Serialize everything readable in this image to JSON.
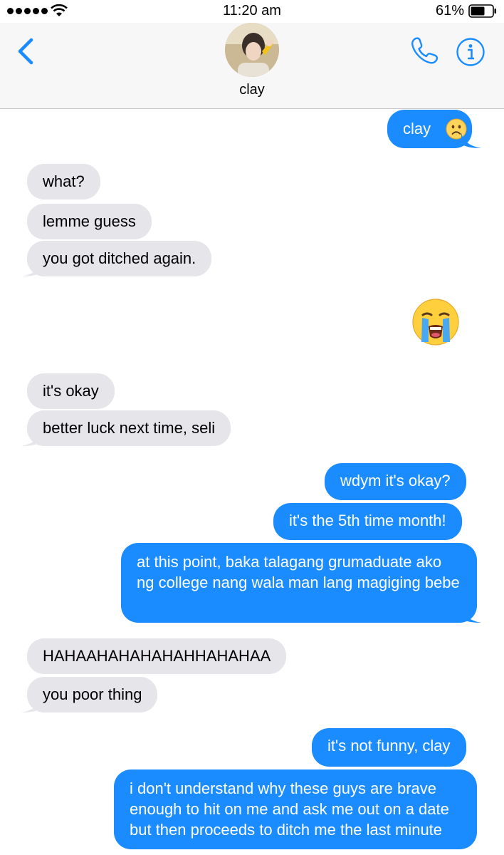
{
  "status_bar": {
    "time": "11:20 am",
    "battery": "61%"
  },
  "header": {
    "contact_name": "clay"
  },
  "messages": [
    {
      "side": "out",
      "text": "clay"
    },
    {
      "side": "in",
      "text": "what?"
    },
    {
      "side": "in",
      "text": "lemme guess"
    },
    {
      "side": "in",
      "text": "you got ditched again."
    },
    {
      "side": "out",
      "text": "😭"
    },
    {
      "side": "in",
      "text": "it's okay"
    },
    {
      "side": "in",
      "text": "better luck next time, seli"
    },
    {
      "side": "out",
      "text": "wdym it's okay?"
    },
    {
      "side": "out",
      "text": "it's the 5th time month!"
    },
    {
      "side": "out",
      "text": "at this point, baka talagang grumaduate ako ng college nang wala man lang magiging bebe"
    },
    {
      "side": "in",
      "text": "HAHAAHAHAHAHAHHAHAHAA"
    },
    {
      "side": "in",
      "text": "you poor thing"
    },
    {
      "side": "out",
      "text": "it's not funny, clay"
    },
    {
      "side": "out",
      "text": "i don't understand why these guys are brave enough to hit on me and ask me out on a date but then proceeds to ditch me the last minute"
    }
  ],
  "colors": {
    "accent": "#1a8cff",
    "incoming_bubble": "#e5e5ea",
    "outgoing_bubble": "#1a8cff"
  },
  "icons": [
    "signal-dots-icon",
    "wifi-icon",
    "battery-icon",
    "back-chevron-icon",
    "phone-icon",
    "info-icon",
    "frowning-face-emoji",
    "loudly-crying-face-emoji"
  ]
}
